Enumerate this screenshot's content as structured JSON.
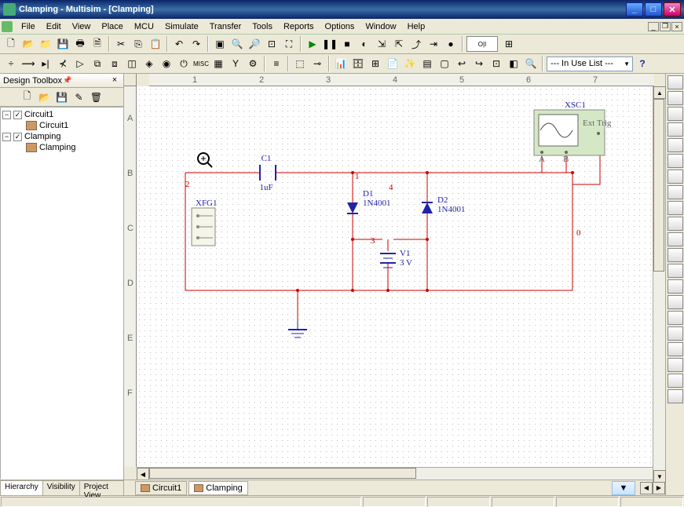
{
  "window": {
    "title": "Clamping - Multisim - [Clamping]"
  },
  "menu": [
    "File",
    "Edit",
    "View",
    "Place",
    "MCU",
    "Simulate",
    "Transfer",
    "Tools",
    "Reports",
    "Options",
    "Window",
    "Help"
  ],
  "in_use_list": "--- In Use List ---",
  "sidebar": {
    "title": "Design Toolbox",
    "tree": [
      {
        "label": "Circuit1",
        "checked": true,
        "children": [
          {
            "label": "Circuit1"
          }
        ]
      },
      {
        "label": "Clamping",
        "checked": true,
        "children": [
          {
            "label": "Clamping"
          }
        ]
      }
    ],
    "tabs": [
      "Hierarchy",
      "Visibility",
      "Project View"
    ]
  },
  "doctabs": [
    "Circuit1",
    "Clamping"
  ],
  "ruler_h": [
    "1",
    "2",
    "3",
    "4",
    "5",
    "6",
    "7"
  ],
  "ruler_v": [
    "A",
    "B",
    "C",
    "D",
    "E",
    "F"
  ],
  "components": {
    "scope": {
      "name": "XSC1"
    },
    "fgen": {
      "name": "XFG1"
    },
    "c1": {
      "name": "C1",
      "value": "1uF"
    },
    "d1": {
      "name": "D1",
      "value": "1N4001"
    },
    "d2": {
      "name": "D2",
      "value": "1N4001"
    },
    "v1": {
      "name": "V1",
      "value": "3 V"
    }
  },
  "nodes": {
    "n0": "0",
    "n1": "1",
    "n2": "2",
    "n3": "3",
    "n4": "4"
  }
}
